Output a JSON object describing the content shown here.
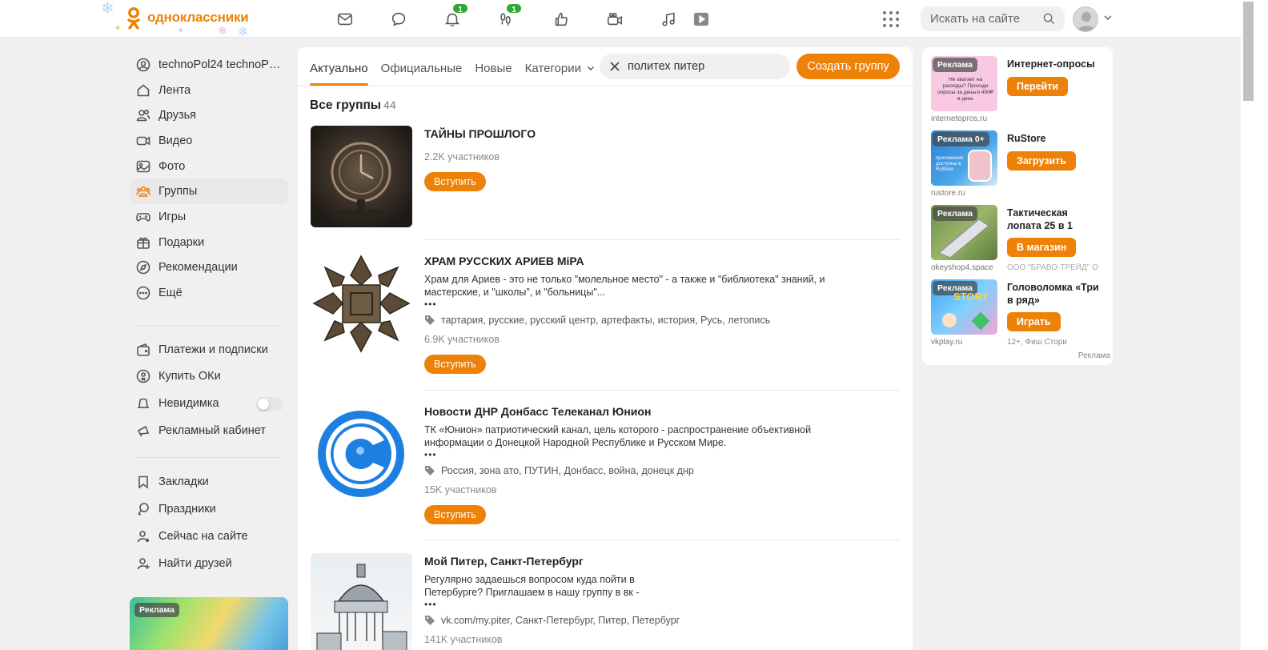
{
  "header": {
    "logo_text": "одноклассники",
    "notifications_badge": "1",
    "guests_badge": "1",
    "search_placeholder": "Искать на сайте"
  },
  "sidebar": {
    "items": [
      {
        "label": "technoPol24 technoPol24",
        "icon": "user-icon"
      },
      {
        "label": "Лента",
        "icon": "home-icon"
      },
      {
        "label": "Друзья",
        "icon": "friends-icon"
      },
      {
        "label": "Видео",
        "icon": "video-icon"
      },
      {
        "label": "Фото",
        "icon": "photo-icon"
      },
      {
        "label": "Группы",
        "icon": "groups-icon"
      },
      {
        "label": "Игры",
        "icon": "gamepad-icon"
      },
      {
        "label": "Подарки",
        "icon": "gift-icon"
      },
      {
        "label": "Рекомендации",
        "icon": "compass-icon"
      },
      {
        "label": "Ещё",
        "icon": "more-icon"
      }
    ],
    "items2": [
      {
        "label": "Платежи и подписки",
        "icon": "wallet-icon"
      },
      {
        "label": "Купить ОКи",
        "icon": "coin-icon"
      },
      {
        "label": "Невидимка",
        "icon": "invisible-icon"
      },
      {
        "label": "Рекламный кабинет",
        "icon": "megaphone-icon"
      }
    ],
    "items3": [
      {
        "label": "Закладки",
        "icon": "bookmark-icon"
      },
      {
        "label": "Праздники",
        "icon": "balloon-icon"
      },
      {
        "label": "Сейчас на сайте",
        "icon": "online-icon"
      },
      {
        "label": "Найти друзей",
        "icon": "add-friend-icon"
      }
    ],
    "ad_badge": "Реклама"
  },
  "main": {
    "tabs": [
      {
        "label": "Актуально"
      },
      {
        "label": "Официальные"
      },
      {
        "label": "Новые"
      },
      {
        "label": "Категории"
      }
    ],
    "search_value": "политех питер",
    "create_button": "Создать группу",
    "all_groups_label": "Все группы",
    "all_groups_count": "44",
    "join_label": "Вступить",
    "groups": [
      {
        "name": "ТАЙНЫ ПРОШЛОГО",
        "description": "",
        "tags": "",
        "members": "2.2K участников"
      },
      {
        "name": "ХРАМ РУССКИХ АРИЕВ МiРА",
        "description": "Храм для Ариев - это не только \"молельное место\" - а также и \"библиотека\" знаний, и мастерские, и \"школы\", и \"больницы\"...",
        "tags": "тартария, русские, русский центр, артефакты, история, Русь, летопись",
        "members": "6.9K участников"
      },
      {
        "name": "Новости ДНР Донбасс Телеканал Юнион",
        "description": "ТК «Юнион» патриотический канал, цель которого - распространение объективной информации о Донецкой Народной Республике и Русском Мире.",
        "tags": "Россия, зона ато, ПУТИН, Донбасс, война, донецк днр",
        "members": "15K участников"
      },
      {
        "name": "Мой Питер, Санкт-Петербург",
        "description": "Регулярно задаешься вопросом куда пойти в Петербурге? Приглашаем в нашу группу в вк -",
        "tags": "vk.com/my.piter, Санкт-Петербург, Питер, Петербург",
        "members": "141K участников"
      }
    ],
    "more_dots": "•••"
  },
  "ads": {
    "items": [
      {
        "badge": "Реклама",
        "title": "Интернет-опросы",
        "button": "Перейти",
        "domain": "internetopros.ru",
        "sub": "",
        "pic_text": "Не хватает на расходы? Проходи опросы за деньги 450₽ в день"
      },
      {
        "badge": "Реклама 0+",
        "title": "RuStore",
        "button": "Загрузить",
        "domain": "rustore.ru",
        "sub": "",
        "pic_text": "приложения доступны в RuStore"
      },
      {
        "badge": "Реклама",
        "title": "Тактическая лопата 25 в 1",
        "button": "В магазин",
        "domain": "okeyshop4.space",
        "sub": "ООО \"БРАВО-ТРЕЙД\" О",
        "pic_text": ""
      },
      {
        "badge": "Реклама",
        "title": "Головоломка «Три в ряд»",
        "button": "Играть",
        "domain": "vkplay.ru",
        "sub": "12+, Фиш Стори",
        "pic_text": "STORY"
      }
    ],
    "footer": "Реклама"
  }
}
